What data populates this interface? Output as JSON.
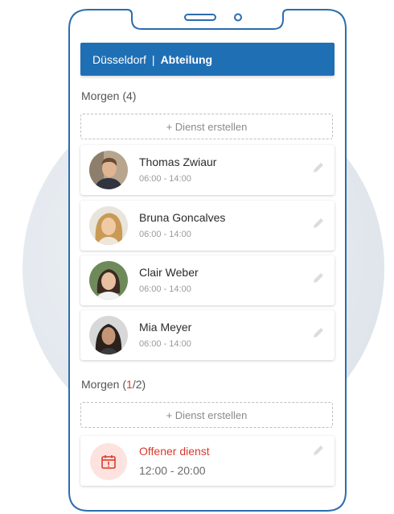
{
  "header": {
    "city": "Düsseldorf",
    "separator": "|",
    "department": "Abteilung"
  },
  "sections": [
    {
      "title_day": "Morgen",
      "title_count": "(4)",
      "add_label": "+ Dienst erstellen",
      "shifts": [
        {
          "name": "Thomas Zwiaur",
          "time": "06:00 - 14:00"
        },
        {
          "name": "Bruna Goncalves",
          "time": "06:00 - 14:00"
        },
        {
          "name": "Clair Weber",
          "time": "06:00 - 14:00"
        },
        {
          "name": "Mia Meyer",
          "time": "06:00 - 14:00"
        }
      ]
    },
    {
      "title_day": "Morgen",
      "title_open": "(",
      "title_filled": "1",
      "title_rest": "/2)",
      "add_label": "+ Dienst erstellen",
      "open_shift": {
        "label": "Offener dienst",
        "time": "12:00 - 20:00"
      }
    }
  ],
  "colors": {
    "brand": "#1f6fb5",
    "alert": "#d93a2b",
    "alert_bg": "#fde3df"
  },
  "icons": {
    "edit": "pencil-icon",
    "open_shift": "calendar-alert-icon"
  }
}
